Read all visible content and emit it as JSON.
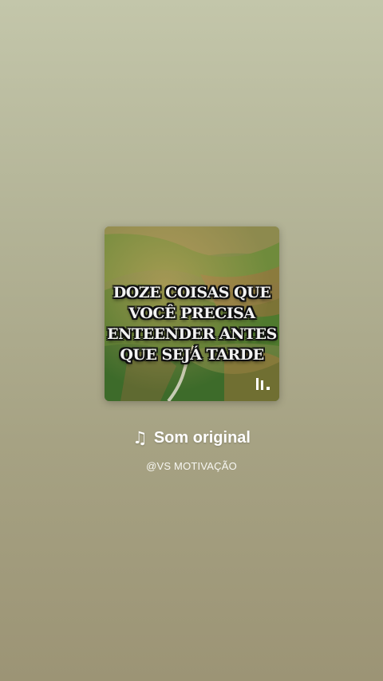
{
  "cover": {
    "title_lines": [
      "DOZE COISAS QUE",
      "VOCÊ PRECISA",
      "ENTEENDER ANTES",
      "QUE SEJÁ TARDE"
    ],
    "watermark_icon": "audio-bars-logo-icon"
  },
  "audio": {
    "icon": "music-note-icon",
    "note_glyph": "♫",
    "title": "Som original",
    "author": "@VS MOTIVAÇÃO"
  },
  "colors": {
    "background_top": "#c3c6aa",
    "background_bottom": "#9c9475",
    "text": "#ffffff"
  }
}
